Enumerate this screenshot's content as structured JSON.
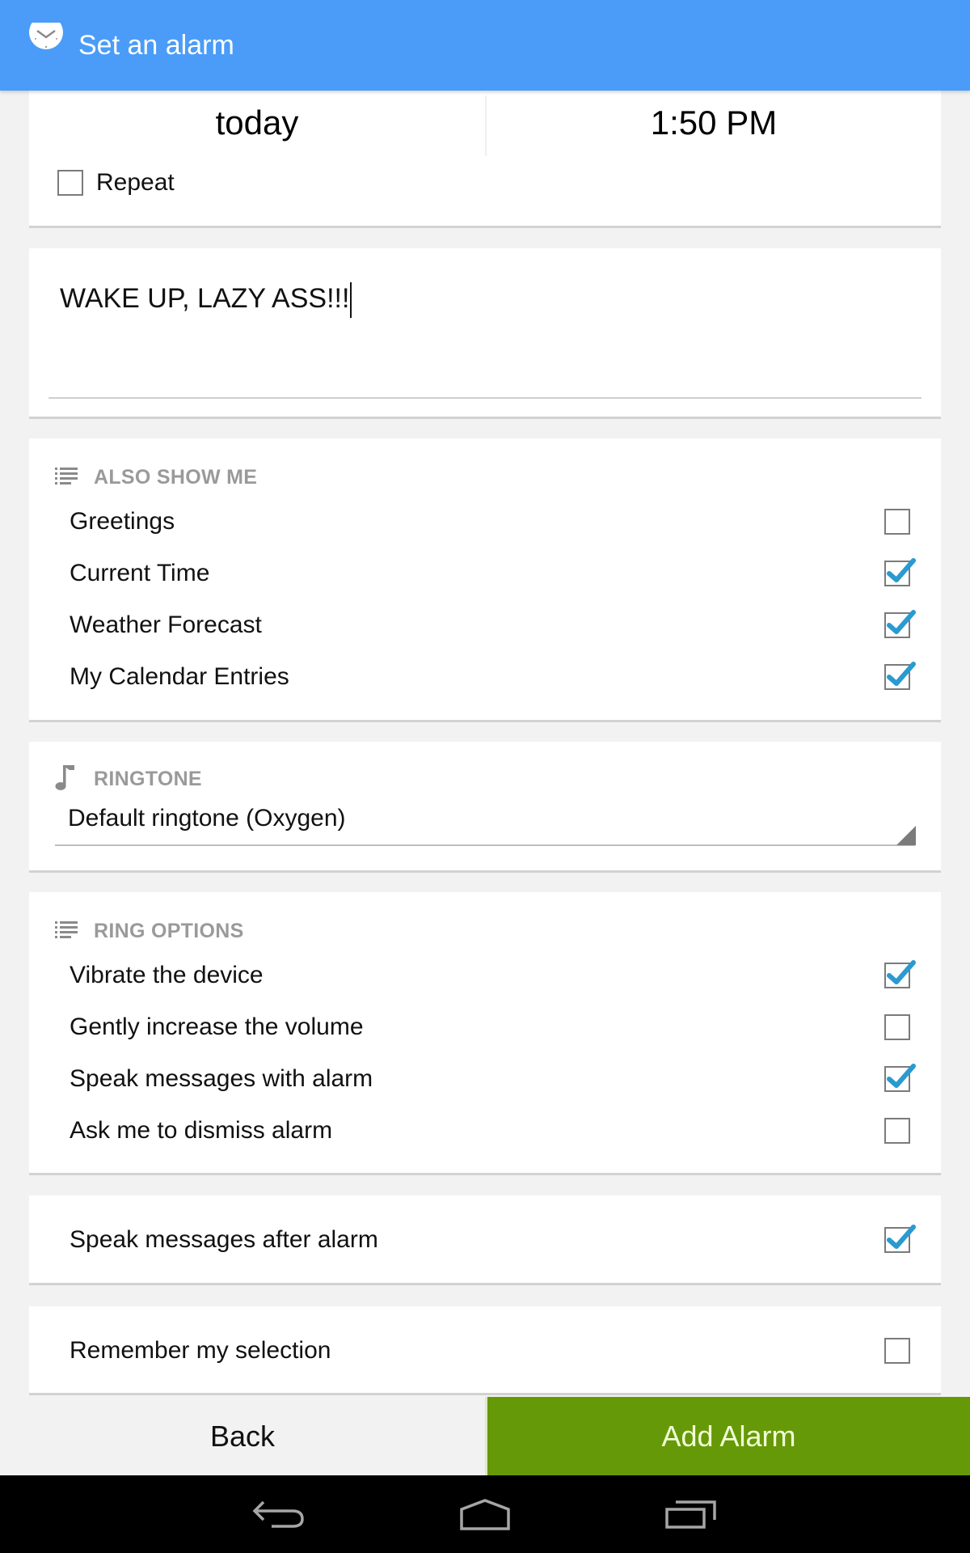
{
  "header": {
    "title": "Set an alarm",
    "icon": "alarm-clock-icon",
    "color": "#4a9cf8"
  },
  "datetime": {
    "date": "today",
    "time": "1:50 PM",
    "repeat": {
      "label": "Repeat",
      "checked": false
    }
  },
  "message": {
    "value": "WAKE UP, LAZY ASS!!!"
  },
  "also_show_me": {
    "heading": "ALSO SHOW ME",
    "icon": "list-icon",
    "items": [
      {
        "label": "Greetings",
        "checked": false
      },
      {
        "label": "Current Time",
        "checked": true
      },
      {
        "label": "Weather Forecast",
        "checked": true
      },
      {
        "label": "My Calendar Entries",
        "checked": true
      }
    ]
  },
  "ringtone": {
    "heading": "RINGTONE",
    "icon": "music-note-icon",
    "selected": "Default ringtone (Oxygen)"
  },
  "ring_options": {
    "heading": "RING OPTIONS",
    "icon": "list-icon",
    "items": [
      {
        "label": "Vibrate the device",
        "checked": true
      },
      {
        "label": "Gently increase the volume",
        "checked": false
      },
      {
        "label": "Speak messages with alarm",
        "checked": true
      },
      {
        "label": "Ask me to dismiss alarm",
        "checked": false
      }
    ]
  },
  "speak_after": {
    "label": "Speak messages after alarm",
    "checked": true
  },
  "remember": {
    "label": "Remember my selection",
    "checked": false
  },
  "actions": {
    "back_label": "Back",
    "add_label": "Add Alarm",
    "add_color": "#669907"
  },
  "navbar": {
    "back": "back-icon",
    "home": "home-icon",
    "recents": "recent-apps-icon"
  },
  "colors": {
    "check": "#2a9ad0",
    "heading": "#9a9a9a"
  }
}
